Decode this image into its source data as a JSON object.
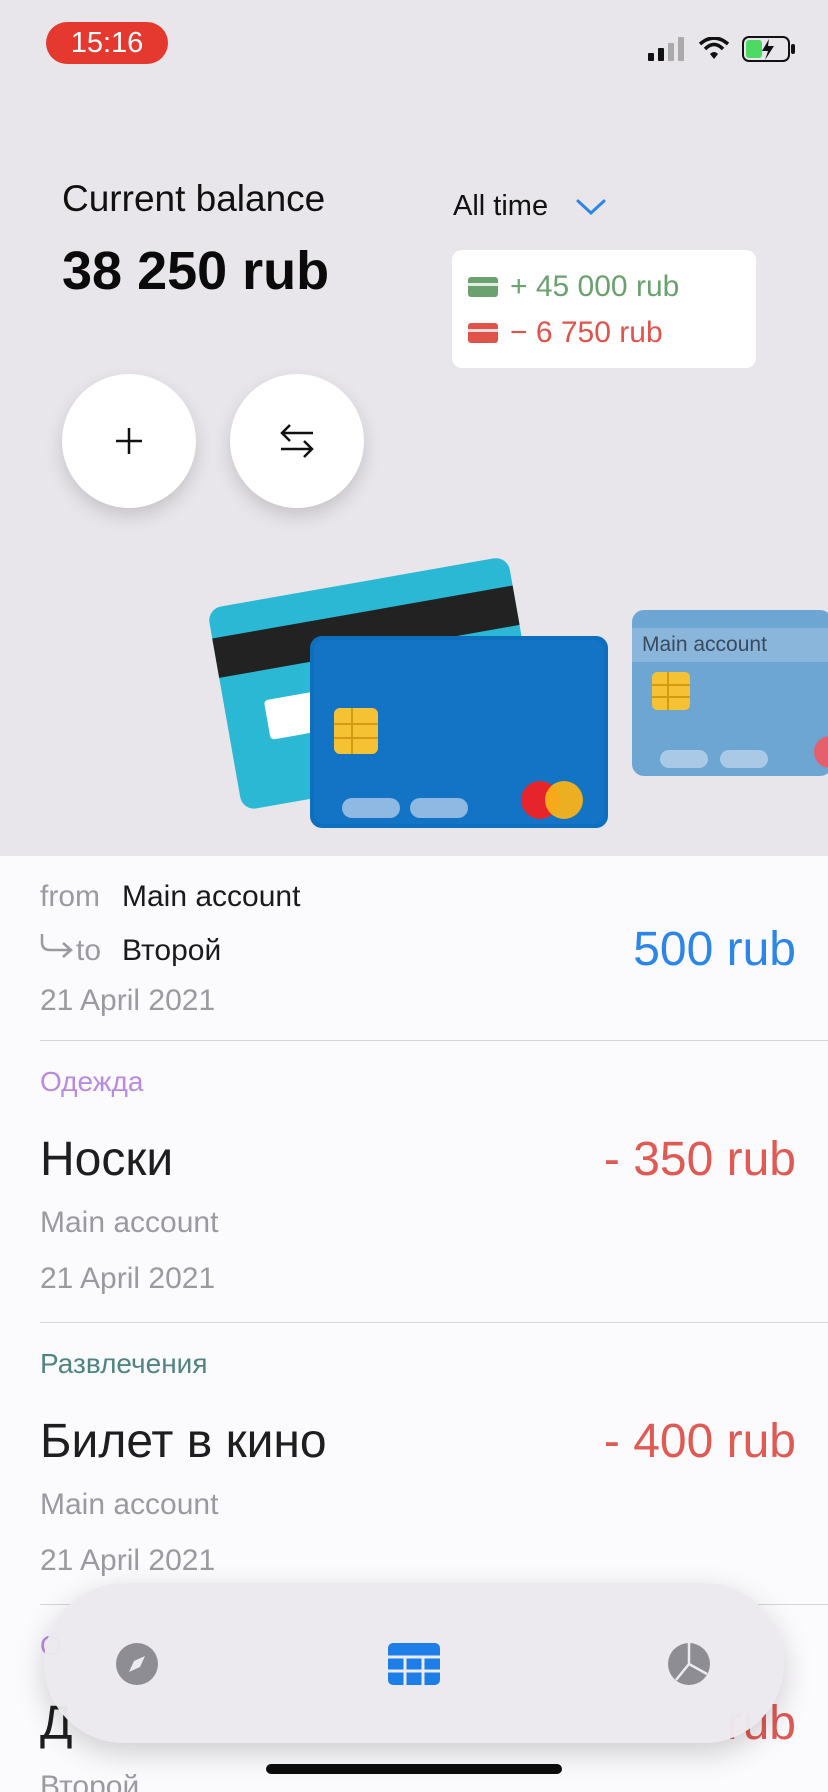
{
  "status": {
    "time": "15:16"
  },
  "balance": {
    "label": "Current balance",
    "value": "38 250 rub"
  },
  "period": {
    "label": "All time"
  },
  "summary": {
    "income": "+ 45 000 rub",
    "expense": "− 6 750 rub"
  },
  "cards": {
    "account_label": "Main account"
  },
  "transfer": {
    "from_label": "from",
    "from_value": "Main account",
    "to_label": "to",
    "to_value": "Второй",
    "amount": "500 rub",
    "date": "21 April 2021"
  },
  "transactions": [
    {
      "category": "Одежда",
      "title": "Носки",
      "amount": "- 350 rub",
      "account": "Main account",
      "date": "21 April 2021",
      "category_color": "#b98be0"
    },
    {
      "category": "Развлечения",
      "title": "Билет в кино",
      "amount": "- 400 rub",
      "account": "Main account",
      "date": "21 April 2021",
      "category_color": "#4f8482"
    },
    {
      "category": "О",
      "title": "Д",
      "amount": "rub",
      "account": "Второй",
      "date": "",
      "category_color": "#b98be0"
    }
  ],
  "colors": {
    "accent": "#2b86e8",
    "expense": "#e05a54",
    "income": "#6aa16f"
  },
  "tabs": [
    {
      "icon": "compass-icon"
    },
    {
      "icon": "grid-icon"
    },
    {
      "icon": "pie-chart-icon"
    }
  ]
}
